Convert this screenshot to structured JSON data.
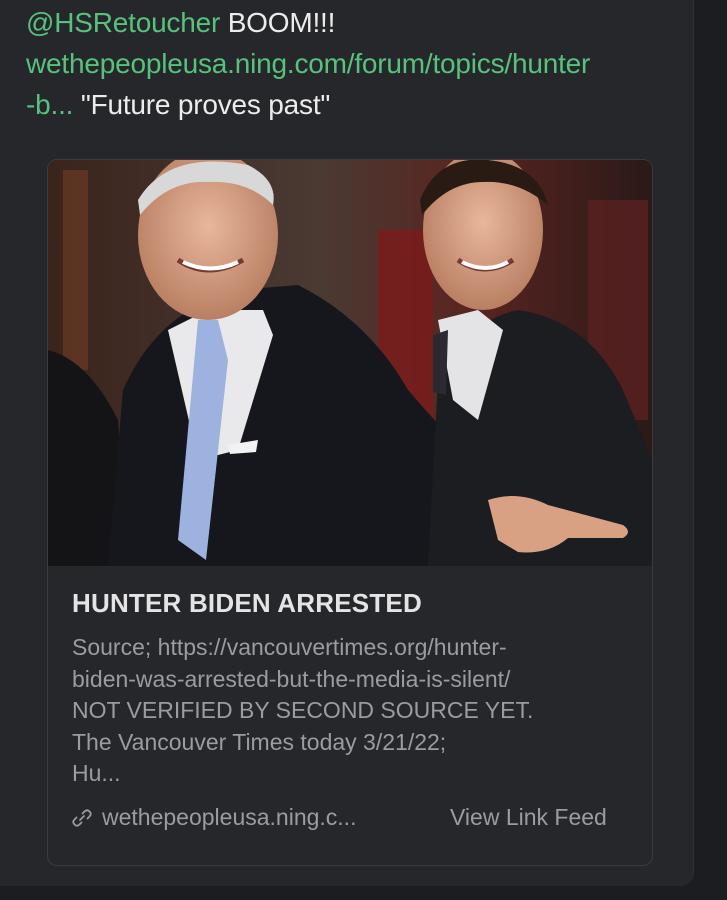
{
  "post": {
    "mention": "@HSRetoucher",
    "text_after_mention": " BOOM!!!",
    "link_line1": "wethepeopleusa.ning.com/forum/topics/hunter",
    "link_line2": "-b...",
    "quote": " \"Future proves past\""
  },
  "card": {
    "title": "HUNTER BIDEN ARRESTED",
    "description": "Source; https://vancouvertimes.org/hunter-\nbiden-was-arrested-but-the-media-is-silent/\nNOT VERIFIED BY SECOND SOURCE YET.\nThe Vancouver Times today 3/21/22;\nHu...",
    "domain": "wethepeopleusa.ning.c...",
    "view_feed_label": "View Link Feed",
    "link_icon": "link-icon"
  },
  "colors": {
    "background": "#1c1d21",
    "post_background": "#26272b",
    "link_green": "#57c17e",
    "text_primary": "#ececec",
    "text_secondary": "#9a9ca3"
  }
}
